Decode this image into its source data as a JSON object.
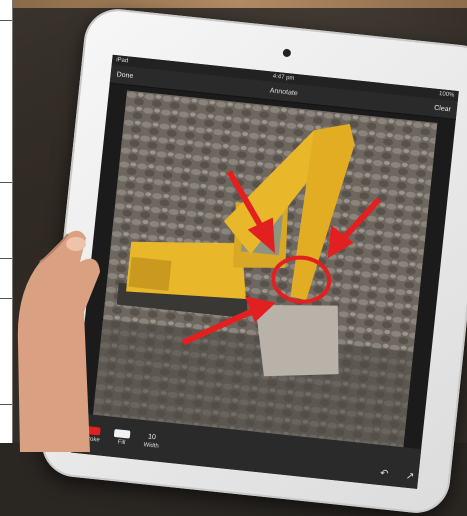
{
  "device": {
    "carrier": "iPad",
    "time": "4:47 pm",
    "battery": "100%"
  },
  "nav": {
    "left_button": "Done",
    "title": "Annotate",
    "right_button": "Clear"
  },
  "toolbar": {
    "color_label": "Stroke",
    "fill_label": "Fill",
    "width_value": "10",
    "width_label": "Width"
  },
  "colors": {
    "annotation": "#e32020",
    "machine_yellow": "#e9b72a"
  },
  "icons": [
    "undo-icon",
    "share-icon"
  ]
}
